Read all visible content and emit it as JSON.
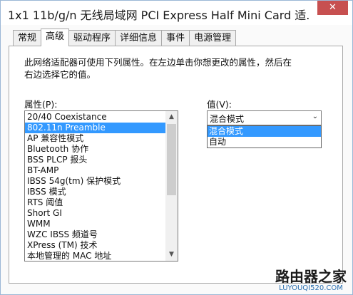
{
  "window": {
    "title": "1x1 11b/g/n 无线局域网 PCI Express Half Mini Card 适..."
  },
  "titlebar": {
    "close_label": "✕"
  },
  "tabs": [
    {
      "label": "常规"
    },
    {
      "label": "高级"
    },
    {
      "label": "驱动程序"
    },
    {
      "label": "详细信息"
    },
    {
      "label": "事件"
    },
    {
      "label": "电源管理"
    }
  ],
  "active_tab": "高级",
  "panel": {
    "description": "此网络适配器可使用下列属性。在左边单击你想更改的属性，然后在右边选择它的值。",
    "property_label": "属性(P):",
    "value_label": "值(V):"
  },
  "properties": {
    "items": [
      "20/40 Coexistance",
      "802.11n Preamble",
      "AP 兼容性模式",
      "Bluetooth 协作",
      "BSS PLCP 报头",
      "BT-AMP",
      "IBSS 54g(tm) 保护模式",
      "IBSS 模式",
      "RTS 阈值",
      "Short GI",
      "WMM",
      "WZC IBSS 频道号",
      "XPress (TM) 技术",
      "本地管理的 MAC 地址"
    ],
    "selected_index": 1,
    "scroll_up": "▲",
    "scroll_down": "▼"
  },
  "value": {
    "selected": "混合模式",
    "arrow": "⌄",
    "options": [
      "混合模式",
      "自动"
    ],
    "highlighted_index": 0
  },
  "watermark": {
    "main": "路由器之家",
    "sub": "LUYOUQI520.COM"
  },
  "colors": {
    "selection": "#3399ff",
    "close_button": "#c75050"
  }
}
